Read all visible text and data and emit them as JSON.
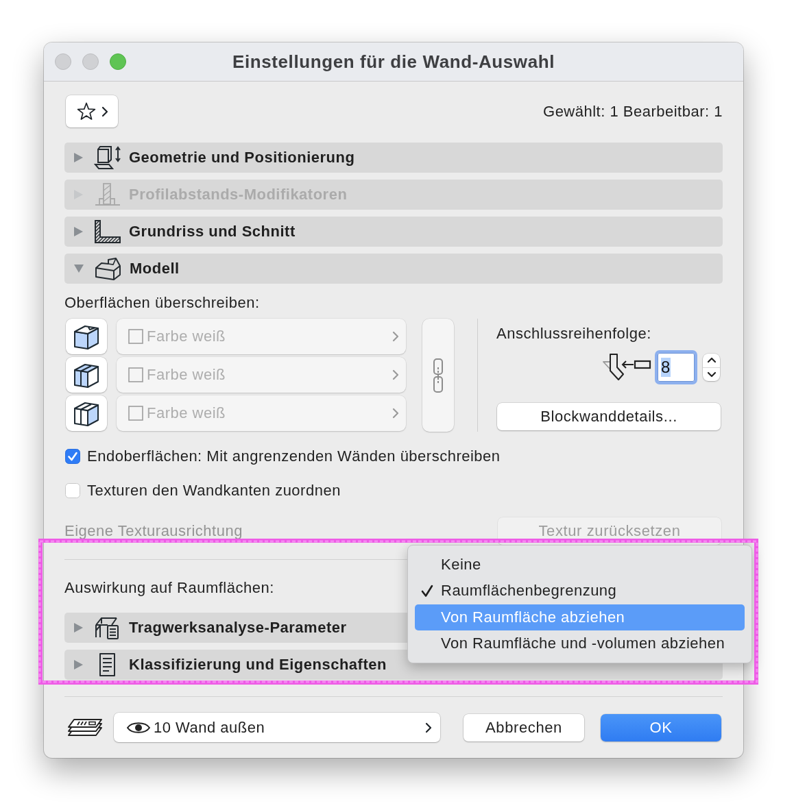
{
  "window": {
    "title": "Einstellungen für die Wand-Auswahl"
  },
  "toolbar": {
    "selection_info": "Gewählt: 1 Bearbeitbar: 1"
  },
  "sections": [
    {
      "label": "Geometrie und Positionierung",
      "kind": "geometry",
      "expanded": false,
      "disabled": false
    },
    {
      "label": "Profilabstands-Modifikatoren",
      "kind": "profile",
      "expanded": false,
      "disabled": true
    },
    {
      "label": "Grundriss und Schnitt",
      "kind": "floorplan",
      "expanded": false,
      "disabled": false
    },
    {
      "label": "Modell",
      "kind": "model",
      "expanded": true,
      "disabled": false
    }
  ],
  "model_settings": {
    "surfaces_label": "Oberflächen überschreiben:",
    "surfaces": [
      {
        "kind": "reference",
        "label": "Farbe weiß",
        "checked": false,
        "disabled": true
      },
      {
        "kind": "opposite",
        "label": "Farbe weiß",
        "checked": false,
        "disabled": true
      },
      {
        "kind": "side",
        "label": "Farbe weiß",
        "checked": false,
        "disabled": true
      }
    ],
    "junction_order": {
      "label": "Anschlussreihenfolge:",
      "value": "8",
      "focused": true
    },
    "details_button": "Blockwanddetails...",
    "options": [
      {
        "label": "Endoberflächen: Mit angrenzenden Wänden überschreiben",
        "checked": true
      },
      {
        "label": "Texturen den Wandkanten zuordnen",
        "checked": false
      }
    ],
    "texture_alignment": {
      "label": "Eigene Texturausrichtung",
      "disabled": true
    },
    "texture_reset_button": {
      "label": "Textur zurücksetzen",
      "disabled": true
    },
    "room_effect_label": "Auswirkung auf Raumflächen:"
  },
  "more_sections": [
    {
      "label": "Tragwerksanalyse-Parameter",
      "kind": "structural",
      "expanded": false,
      "disabled": false
    },
    {
      "label": "Klassifizierung und Eigenschaften",
      "kind": "classification",
      "expanded": false,
      "disabled": false
    }
  ],
  "popup_menu": {
    "items": [
      {
        "label": "Keine",
        "checked": false,
        "selected": false
      },
      {
        "label": "Raumflächenbegrenzung",
        "checked": true,
        "selected": false
      },
      {
        "label": "Von Raumfläche abziehen",
        "checked": false,
        "selected": true
      },
      {
        "label": "Von Raumfläche und -volumen abziehen",
        "checked": false,
        "selected": false
      }
    ]
  },
  "footer": {
    "layer": "10 Wand außen",
    "buttons": [
      {
        "label": "Abbrechen",
        "kind": "cancel"
      },
      {
        "label": "OK",
        "kind": "default"
      }
    ]
  },
  "highlight_frame": true
}
